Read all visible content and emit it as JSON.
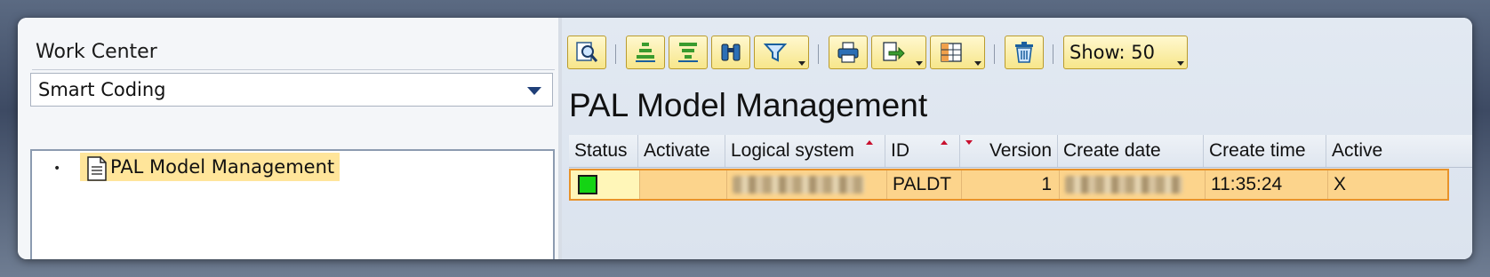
{
  "work_center": {
    "label": "Work Center",
    "selected": "Smart Coding",
    "tree": [
      {
        "label": "PAL Model Management",
        "icon": "document-icon",
        "selected": true
      }
    ]
  },
  "toolbar": {
    "buttons": [
      {
        "name": "details-magnifier-icon"
      },
      {
        "name": "sort-ascending-icon"
      },
      {
        "name": "sort-descending-icon"
      },
      {
        "name": "binoculars-find-icon"
      },
      {
        "name": "filter-icon",
        "dropdown": true
      },
      {
        "name": "print-icon"
      },
      {
        "name": "export-icon",
        "dropdown": true
      },
      {
        "name": "layout-icon",
        "dropdown": true
      },
      {
        "name": "delete-trash-icon"
      }
    ],
    "show_label": "Show: 50"
  },
  "main": {
    "title": "PAL Model Management",
    "columns": [
      "Status",
      "Activate",
      "Logical system",
      "ID",
      "Version",
      "Create date",
      "Create time",
      "Active"
    ],
    "rows": [
      {
        "status": "green",
        "activate": "",
        "logical_system": "",
        "id": "PALDT",
        "version": "1",
        "create_date": "",
        "create_time": "11:35:24",
        "active": "X"
      }
    ]
  },
  "colors": {
    "accent_row": "#fcd48c",
    "row_border": "#e8922a",
    "status_green": "#14d414",
    "tree_highlight": "#ffe59a",
    "sort_indicator": "#c8102e"
  }
}
